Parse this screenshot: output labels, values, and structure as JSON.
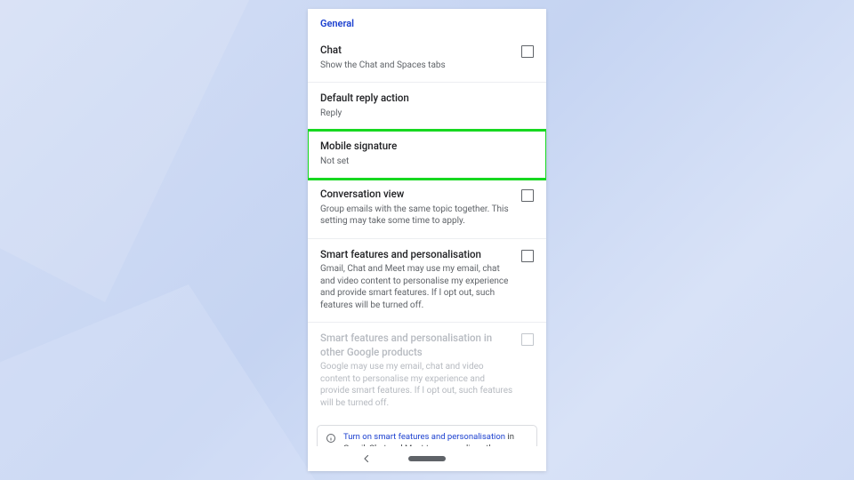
{
  "header": {
    "title": "General"
  },
  "rows": {
    "chat": {
      "title": "Chat",
      "sub": "Show the Chat and Spaces tabs"
    },
    "reply": {
      "title": "Default reply action",
      "sub": "Reply"
    },
    "signature": {
      "title": "Mobile signature",
      "sub": "Not set"
    },
    "conv": {
      "title": "Conversation view",
      "sub": "Group emails with the same topic together. This setting may take some time to apply."
    },
    "smart": {
      "title": "Smart features and personalisation",
      "sub": "Gmail, Chat and Meet may use my email, chat and video content to personalise my experience and provide smart features. If I opt out, such features will be turned off."
    },
    "smart2": {
      "title": "Smart features and personalisation in other Google products",
      "sub": "Google may use my email, chat and video content to personalise my experience and provide smart features. If I opt out, such features will be turned off."
    }
  },
  "notice": {
    "link": "Turn on smart features and personalisation",
    "rest": " in Gmail, Chat and Meet to personalise other Google products"
  }
}
